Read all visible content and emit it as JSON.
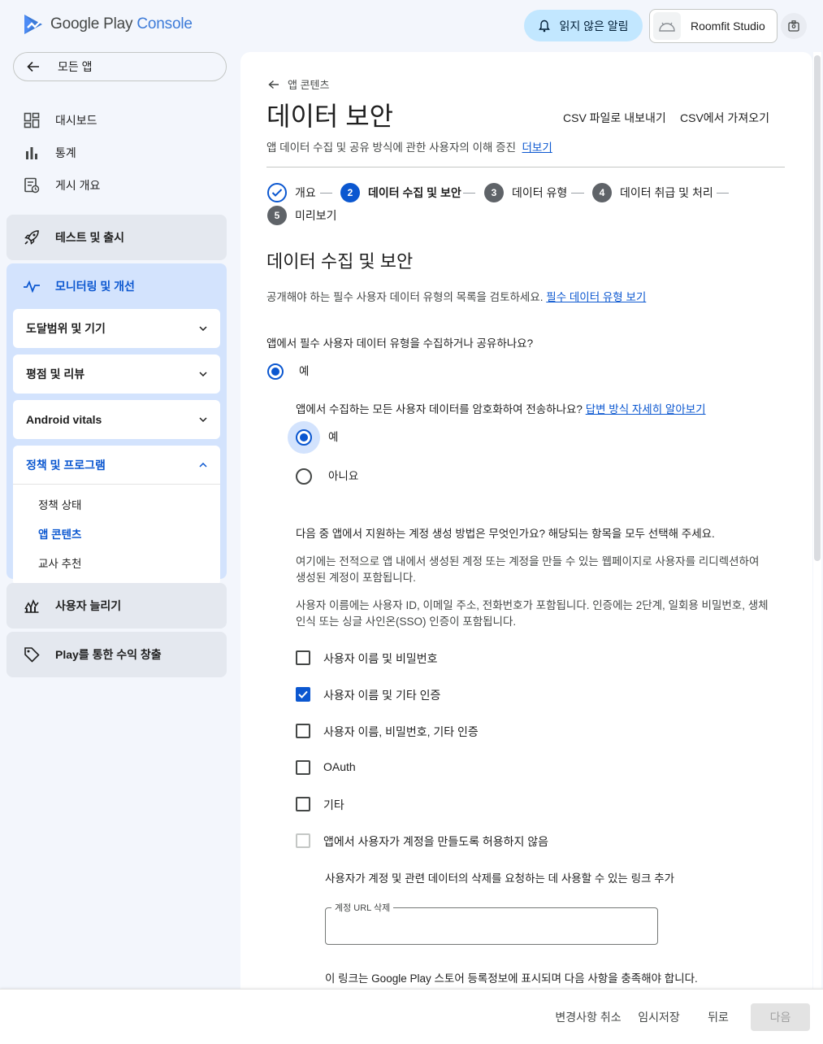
{
  "brand": {
    "name_a": "Google Play",
    "name_b": "Console"
  },
  "header": {
    "notifications_label": "읽지 않은 알림",
    "studio_name": "Roomfit Studio"
  },
  "sidebar": {
    "all_apps": "모든 앱",
    "items": [
      {
        "label": "대시보드",
        "icon": "dashboard-icon"
      },
      {
        "label": "통계",
        "icon": "bar-chart-icon"
      },
      {
        "label": "게시 개요",
        "icon": "publishing-overview-icon"
      }
    ],
    "test_release": "테스트 및 출시",
    "monitor": {
      "label": "모니터링 및 개선",
      "sections": [
        {
          "label": "도달범위 및 기기"
        },
        {
          "label": "평점 및 리뷰"
        },
        {
          "label": "Android vitals"
        },
        {
          "label": "정책 및 프로그램"
        }
      ],
      "policy_links": [
        "정책 상태",
        "앱 콘텐츠",
        "교사 추천"
      ]
    },
    "grow_users": "사용자 늘리기",
    "monetize": "Play를 통한 수익 창출"
  },
  "page": {
    "breadcrumb": "앱 콘텐츠",
    "title": "데이터 보안",
    "export_csv": "CSV 파일로 내보내기",
    "import_csv": "CSV에서 가져오기",
    "subtitle": "앱 데이터 수집 및 공유 방식에 관한 사용자의 이해 증진",
    "learn_more": "더보기"
  },
  "stepper": {
    "steps": [
      {
        "num": "1",
        "label": "개요",
        "state": "done"
      },
      {
        "num": "2",
        "label": "데이터 수집 및 보안",
        "state": "current"
      },
      {
        "num": "3",
        "label": "데이터 유형",
        "state": "pending"
      },
      {
        "num": "4",
        "label": "데이터 취급 및 처리",
        "state": "pending"
      },
      {
        "num": "5",
        "label": "미리보기",
        "state": "pending"
      }
    ]
  },
  "section": {
    "title": "데이터 수집 및 보안",
    "intro": "공개해야 하는 필수 사용자 데이터 유형의 목록을 검토하세요.",
    "intro_link": "필수 데이터 유형 보기",
    "q1": "앱에서 필수 사용자 데이터 유형을 수집하거나 공유하나요?",
    "q1_yes": "예",
    "q2": "앱에서 수집하는 모든 사용자 데이터를 암호화하여 전송하나요?",
    "q2_link": "답변 방식 자세히 알아보기",
    "q2_yes": "예",
    "q2_no": "아니요",
    "q3": "다음 중 앱에서 지원하는 계정 생성 방법은 무엇인가요? 해당되는 항목을 모두 선택해 주세요.",
    "q3_help1_l1": "여기에는 전적으로 앱 내에서 생성된 계정 또는 계정을 만들 수 있는 웹페이지로 사용자를 리디렉션하여",
    "q3_help1_l2": "생성된 계정이 포함됩니다.",
    "q3_help2_l1": "사용자 이름에는 사용자 ID, 이메일 주소, 전화번호가 포함됩니다. 인증에는 2단계, 일회용 비밀번호, 생체",
    "q3_help2_l2": "인식 또는 싱글 사인온(SSO) 인증이 포함됩니다.",
    "options": [
      {
        "label": "사용자 이름 및 비밀번호",
        "checked": false
      },
      {
        "label": "사용자 이름 및 기타 인증",
        "checked": true
      },
      {
        "label": "사용자 이름, 비밀번호, 기타 인증",
        "checked": false
      },
      {
        "label": "OAuth",
        "checked": false
      },
      {
        "label": "기타",
        "checked": false
      },
      {
        "label": "앱에서 사용자가 계정을 만들도록 허용하지 않음",
        "checked": false
      }
    ],
    "delete_link_prompt": "사용자가 계정 및 관련 데이터의 삭제를 요청하는 데 사용할 수 있는 링크 추가",
    "delete_url_label": "계정 URL 삭제",
    "delete_url_value": "",
    "store_note": "이 링크는 Google Play 스토어 등록정보에 표시되며 다음 사항을 충족해야 합니다."
  },
  "footer": {
    "discard": "변경사항 취소",
    "save_draft": "임시저장",
    "back": "뒤로",
    "next": "다음"
  },
  "colors": {
    "accent": "#0b57d0",
    "nav_active_bg": "#d3e3fd",
    "notif_bg": "#c2e7ff"
  }
}
